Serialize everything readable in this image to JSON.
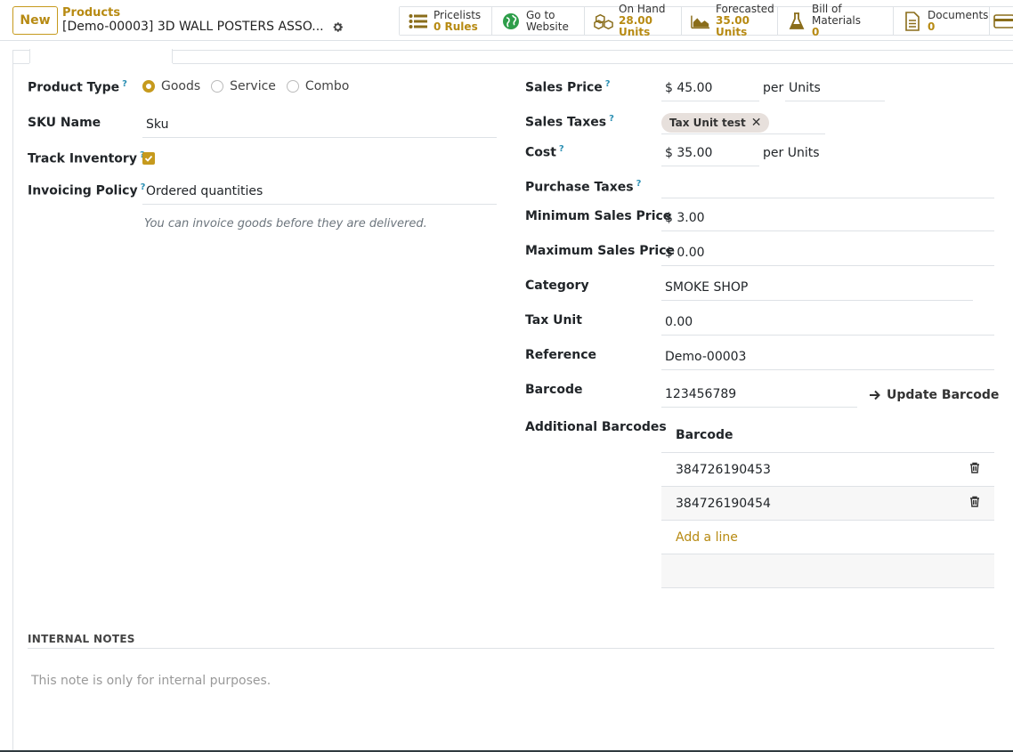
{
  "header": {
    "new_label": "New",
    "breadcrumb": "Products",
    "record_title": "[Demo-00003] 3D WALL POSTERS ASSO...",
    "smart_buttons": [
      {
        "label": "Pricelists",
        "value": "0 Rules",
        "icon": "list-icon"
      },
      {
        "label": "Go to",
        "value": "Website",
        "icon": "globe-icon"
      },
      {
        "label": "On Hand",
        "value": "28.00 Units",
        "icon": "cubes-icon"
      },
      {
        "label": "Forecasted",
        "value": "35.00 Units",
        "icon": "area-chart-icon"
      },
      {
        "label": "Bill of Materials",
        "value": "0",
        "icon": "flask-icon"
      },
      {
        "label": "Documents",
        "value": "0",
        "icon": "file-icon"
      }
    ]
  },
  "left": {
    "product_type_label": "Product Type",
    "product_type_options": [
      "Goods",
      "Service",
      "Combo"
    ],
    "product_type_selected": "Goods",
    "sku_label": "SKU Name",
    "sku_value": "Sku",
    "track_label": "Track Inventory",
    "track_checked": true,
    "invoicing_label": "Invoicing Policy",
    "invoicing_value": "Ordered quantities",
    "invoicing_note": "You can invoice goods before they are delivered."
  },
  "right": {
    "sales_price_label": "Sales Price",
    "sales_price_value": "$ 45.00",
    "per_label": "per",
    "sales_uom": "Units",
    "sales_taxes_label": "Sales Taxes",
    "sales_tax_tag": "Tax Unit test",
    "cost_label": "Cost",
    "cost_value": "$ 35.00",
    "cost_per": "per Units",
    "purchase_taxes_label": "Purchase Taxes",
    "min_price_label": "Minimum Sales Price",
    "min_price_value": "$ 3.00",
    "max_price_label": "Maximum Sales Price",
    "max_price_value": "$ 0.00",
    "category_label": "Category",
    "category_value": "SMOKE SHOP",
    "tax_unit_label": "Tax Unit",
    "tax_unit_value": "0.00",
    "reference_label": "Reference",
    "reference_value": "Demo-00003",
    "barcode_label": "Barcode",
    "barcode_value": "123456789",
    "update_barcode_label": "Update Barcode",
    "additional_barcodes_label": "Additional Barcodes",
    "barcodes_header": "Barcode",
    "barcodes": [
      "384726190453",
      "384726190454"
    ],
    "add_line_label": "Add a line"
  },
  "notes": {
    "title": "INTERNAL NOTES",
    "placeholder": "This note is only for internal purposes."
  },
  "colors": {
    "accent": "#c69a1d",
    "help": "#2b8fb3"
  }
}
